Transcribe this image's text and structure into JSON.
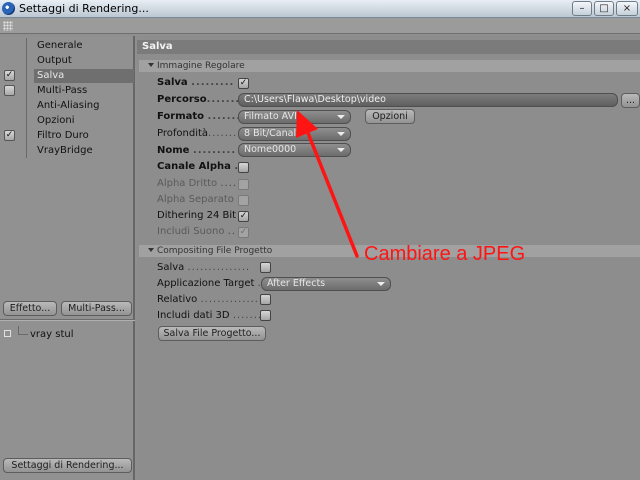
{
  "window": {
    "title": "Settaggi di Rendering...",
    "controls": [
      "–",
      "□",
      "×"
    ]
  },
  "nav": {
    "items": [
      {
        "label": "Generale",
        "checked": null,
        "selected": false
      },
      {
        "label": "Output",
        "checked": null,
        "selected": false
      },
      {
        "label": "Salva",
        "checked": true,
        "selected": true
      },
      {
        "label": "Multi-Pass",
        "checked": false,
        "selected": false
      },
      {
        "label": "Anti-Aliasing",
        "checked": null,
        "selected": false
      },
      {
        "label": "Opzioni",
        "checked": null,
        "selected": false
      },
      {
        "label": "Filtro Duro",
        "checked": true,
        "selected": false
      },
      {
        "label": "VrayBridge",
        "checked": null,
        "selected": false
      }
    ],
    "effetto_button": "Effetto...",
    "multipass_button": "Multi-Pass...",
    "render_settings_item": "vray stul",
    "render_settings_button": "Settaggi di Rendering..."
  },
  "panel": {
    "title": "Salva",
    "group_regular": "Immagine Regolare",
    "salva_label": "Salva",
    "percorso_label": "Percorso",
    "percorso_value": "C:\\Users\\Flawa\\Desktop\\video",
    "browse_button": "...",
    "formato_label": "Formato",
    "formato_value": "Filmato AVI",
    "opzioni_button": "Opzioni",
    "profondita_label": "Profondità",
    "profondita_value": "8 Bit/Canale",
    "nome_label": "Nome",
    "nome_value": "Nome0000",
    "canale_alpha_label": "Canale Alpha",
    "alpha_dritto_label": "Alpha Dritto",
    "alpha_separato_label": "Alpha Separato",
    "dithering_label": "Dithering 24 Bit",
    "includi_suono_label": "Includi Suono",
    "group_compositing": "Compositing File Progetto",
    "comp_salva_label": "Salva",
    "applicazione_label": "Applicazione Target",
    "applicazione_value": "After Effects",
    "relativo_label": "Relativo",
    "includi_3d_label": "Includi dati 3D",
    "salva_file_button": "Salva File Progetto...",
    "dots_short": ".........",
    "dots_med": ".......",
    "dots_long": "..............."
  },
  "annotation": {
    "text": "Cambiare a JPEG",
    "color": "#ff1414"
  },
  "checks": {
    "on": "✓",
    "off": ""
  }
}
